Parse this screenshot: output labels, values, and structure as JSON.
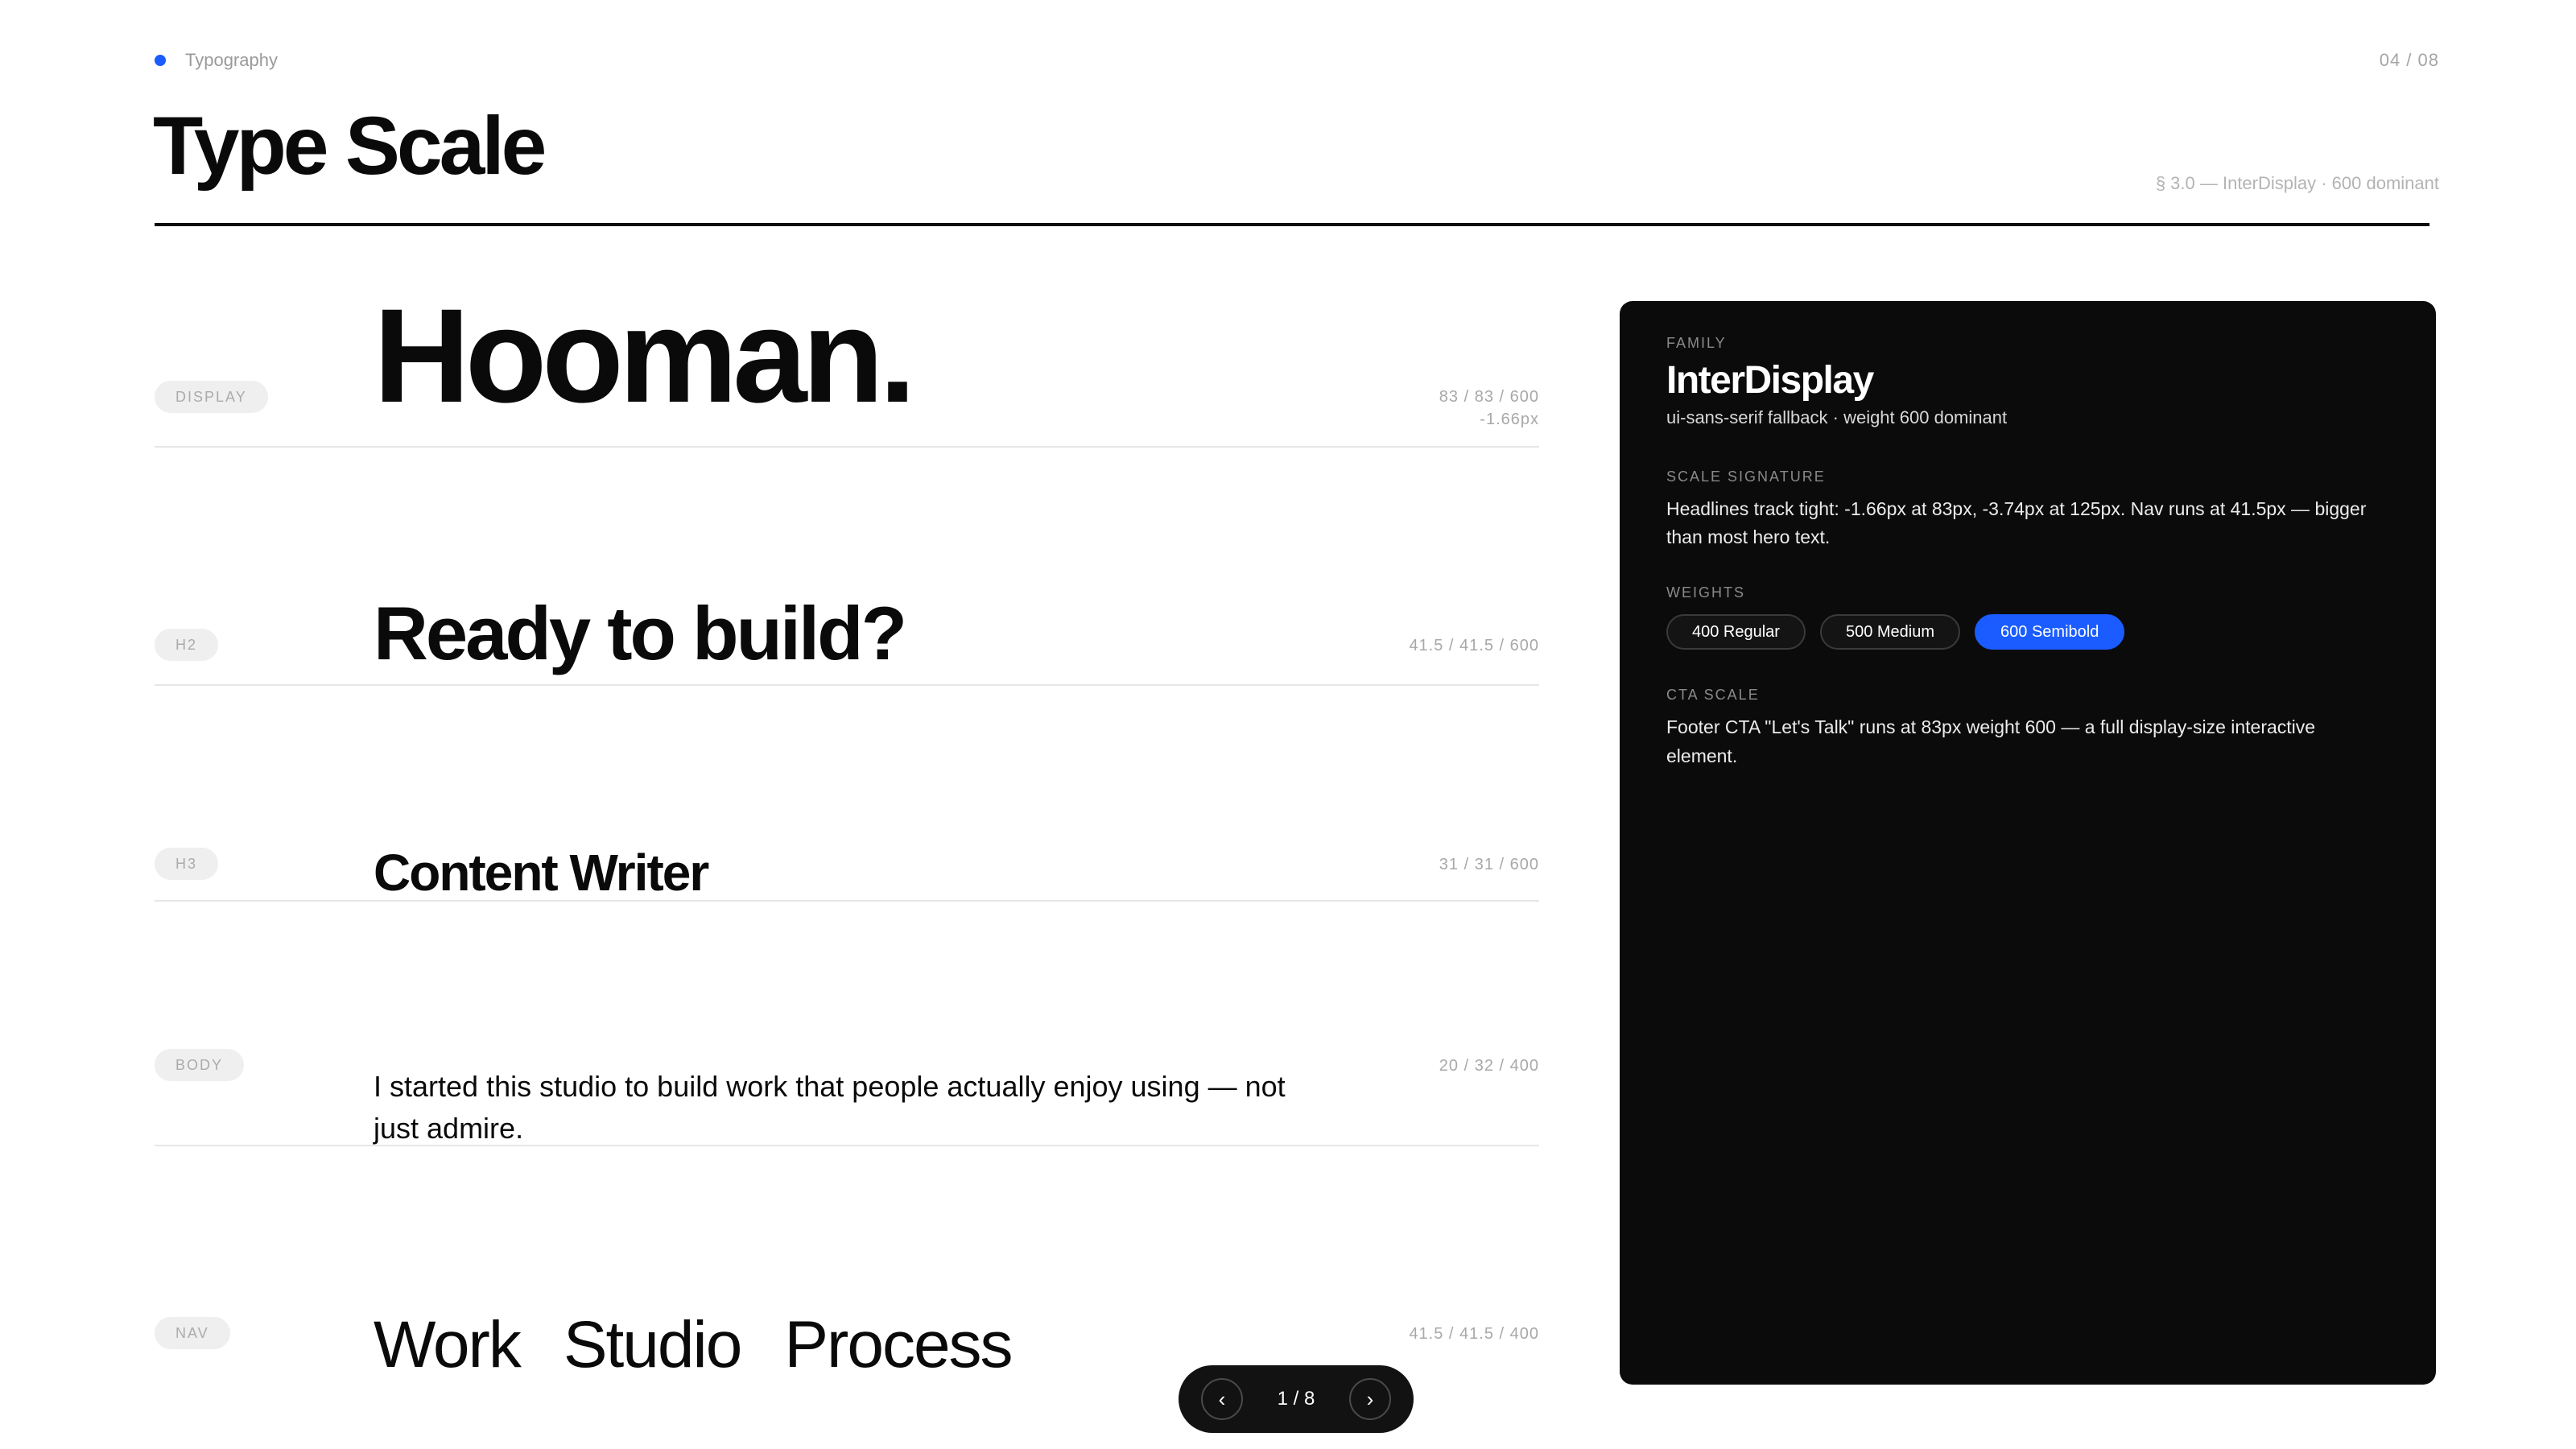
{
  "header": {
    "eyebrow": "Typography",
    "page_counter": "04 / 08",
    "title": "Type Scale",
    "section_meta": "§ 3.0 — InterDisplay · 600 dominant",
    "accent": "#1a5cff"
  },
  "rows": [
    {
      "tag": "DISPLAY",
      "sample": "Hooman.",
      "meta": "83 / 83 / 600",
      "meta_extra": "-1.66px"
    },
    {
      "tag": "H2",
      "sample": "Ready to build?",
      "meta": "41.5 / 41.5 / 600"
    },
    {
      "tag": "H3",
      "sample": "Content Writer",
      "meta": "31 / 31 / 600"
    },
    {
      "tag": "BODY",
      "sample": "I started this studio to build work that people actually enjoy using — not just admire.",
      "meta": "20 / 32 / 400"
    },
    {
      "tag": "NAV",
      "nav_items": [
        "Work",
        "Studio",
        "Process"
      ],
      "meta": "41.5 / 41.5 / 400"
    }
  ],
  "card": {
    "family_label": "FAMILY",
    "family": "InterDisplay",
    "family_sub": "ui-sans-serif fallback · weight 600 dominant",
    "signature_label": "SCALE SIGNATURE",
    "signature_text": "Headlines track tight: -1.66px at 83px, -3.74px at 125px. Nav runs at 41.5px — bigger than most hero text.",
    "weights_label": "WEIGHTS",
    "weights": [
      {
        "label": "400 Regular",
        "active": false
      },
      {
        "label": "500 Medium",
        "active": false
      },
      {
        "label": "600 Semibold",
        "active": true
      }
    ],
    "cta_label": "CTA SCALE",
    "cta_text": "Footer CTA \"Let's Talk\" runs at 83px weight 600 — a full display-size interactive element."
  },
  "pager": {
    "prev_icon": "chevron-left-icon",
    "next_icon": "chevron-right-icon",
    "count": "1 / 8"
  }
}
